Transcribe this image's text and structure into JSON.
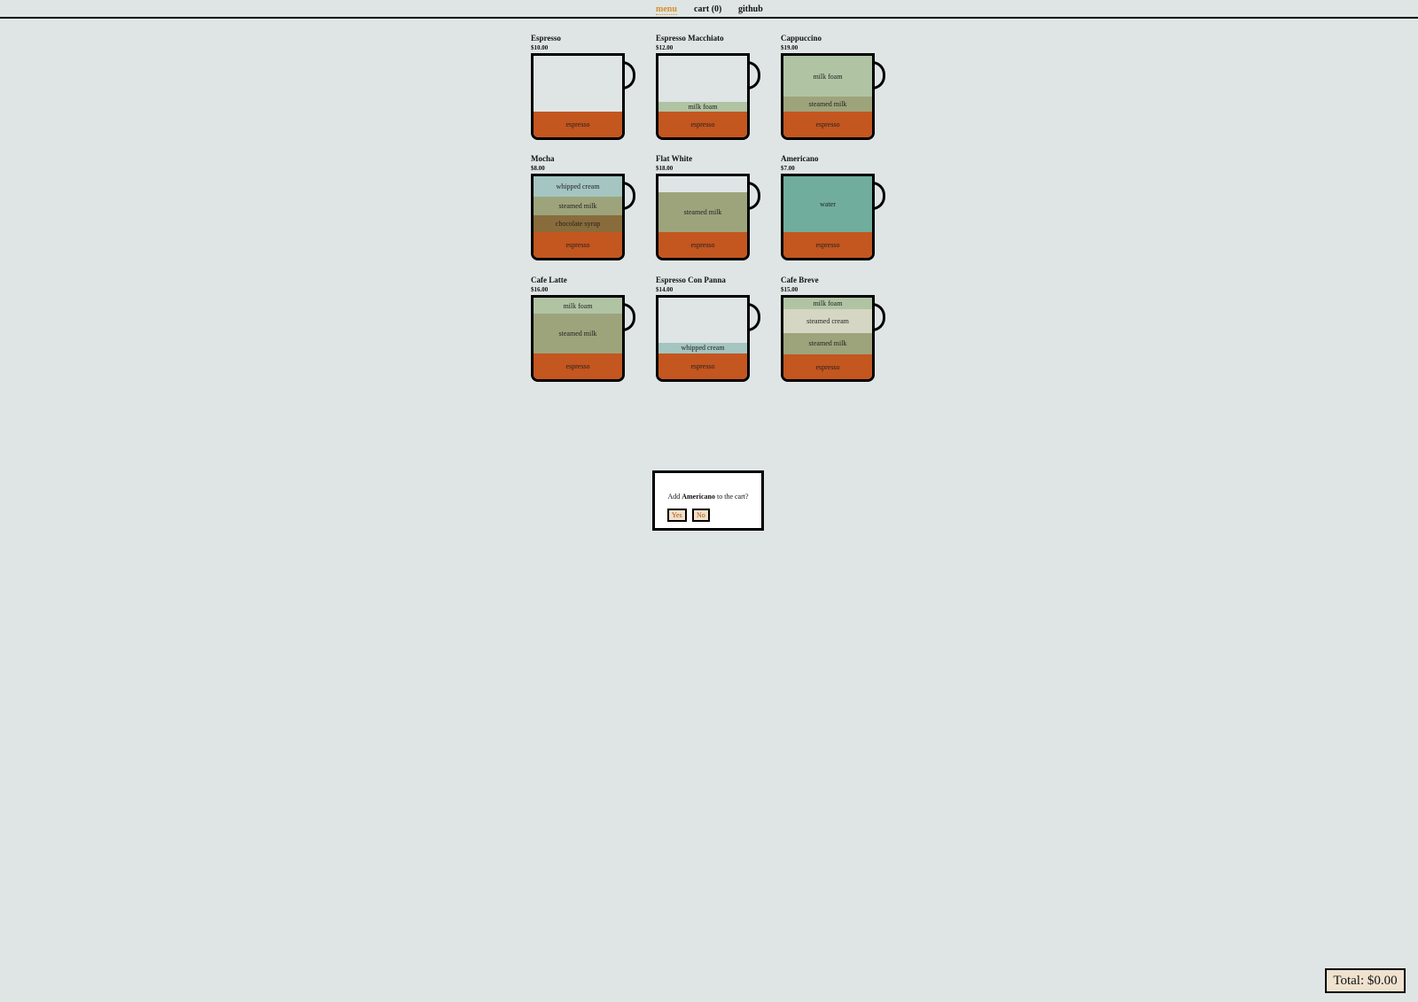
{
  "nav": {
    "menu_label": "menu",
    "cart_label": "cart (0)",
    "github_label": "github"
  },
  "colors": {
    "background": "#dfe5e5",
    "active_nav": "#d4902a",
    "espresso": "#c4561f",
    "milk_foam": "#b0c4a4",
    "steamed_milk": "#9da47b",
    "chocolate_syrup": "#896c3b",
    "whipped_cream": "#a4c5c1",
    "water": "#70ad9c",
    "steamed_cream": "#d5d6c3",
    "button_bg": "#f0e0c8",
    "total_bg": "#efe2cf"
  },
  "products": [
    {
      "name": "Espresso",
      "price": "$10.00",
      "empty_fraction": 0.68,
      "layers": [
        {
          "label": "espresso",
          "color": "#c4561f",
          "fraction": 0.32
        }
      ]
    },
    {
      "name": "Espresso Macchiato",
      "price": "$12.00",
      "empty_fraction": 0.56,
      "layers": [
        {
          "label": "milk foam",
          "color": "#b0c4a4",
          "fraction": 0.12
        },
        {
          "label": "espresso",
          "color": "#c4561f",
          "fraction": 0.32
        }
      ]
    },
    {
      "name": "Cappuccino",
      "price": "$19.00",
      "empty_fraction": 0,
      "layers": [
        {
          "label": "milk foam",
          "color": "#b0c4a4",
          "fraction": 0.5
        },
        {
          "label": "steamed milk",
          "color": "#9da47b",
          "fraction": 0.18
        },
        {
          "label": "espresso",
          "color": "#c4561f",
          "fraction": 0.32
        }
      ]
    },
    {
      "name": "Mocha",
      "price": "$8.00",
      "empty_fraction": 0,
      "layers": [
        {
          "label": "whipped cream",
          "color": "#a4c5c1",
          "fraction": 0.25
        },
        {
          "label": "steamed milk",
          "color": "#9da47b",
          "fraction": 0.23
        },
        {
          "label": "chocolate syrup",
          "color": "#896c3b",
          "fraction": 0.2
        },
        {
          "label": "espresso",
          "color": "#c4561f",
          "fraction": 0.32
        }
      ]
    },
    {
      "name": "Flat White",
      "price": "$18.00",
      "empty_fraction": 0.2,
      "layers": [
        {
          "label": "steamed milk",
          "color": "#9da47b",
          "fraction": 0.48
        },
        {
          "label": "espresso",
          "color": "#c4561f",
          "fraction": 0.32
        }
      ]
    },
    {
      "name": "Americano",
      "price": "$7.00",
      "empty_fraction": 0,
      "layers": [
        {
          "label": "water",
          "color": "#70ad9c",
          "fraction": 0.68
        },
        {
          "label": "espresso",
          "color": "#c4561f",
          "fraction": 0.32
        }
      ]
    },
    {
      "name": "Cafe Latte",
      "price": "$16.00",
      "empty_fraction": 0,
      "layers": [
        {
          "label": "milk foam",
          "color": "#b0c4a4",
          "fraction": 0.2
        },
        {
          "label": "steamed milk",
          "color": "#9da47b",
          "fraction": 0.48
        },
        {
          "label": "espresso",
          "color": "#c4561f",
          "fraction": 0.32
        }
      ]
    },
    {
      "name": "Espresso Con Panna",
      "price": "$14.00",
      "empty_fraction": 0.55,
      "layers": [
        {
          "label": "whipped cream",
          "color": "#a4c5c1",
          "fraction": 0.13
        },
        {
          "label": "espresso",
          "color": "#c4561f",
          "fraction": 0.32
        }
      ]
    },
    {
      "name": "Cafe Breve",
      "price": "$15.00",
      "empty_fraction": 0,
      "layers": [
        {
          "label": "milk foam",
          "color": "#b0c4a4",
          "fraction": 0.14
        },
        {
          "label": "steamed cream",
          "color": "#d5d6c3",
          "fraction": 0.29
        },
        {
          "label": "steamed milk",
          "color": "#9da47b",
          "fraction": 0.27
        },
        {
          "label": "espresso",
          "color": "#c4561f",
          "fraction": 0.3
        }
      ]
    }
  ],
  "modal": {
    "prefix": "Add",
    "product": "Americano",
    "suffix": "to the cart?",
    "yes_label": "Yes",
    "no_label": "No"
  },
  "cart": {
    "total_label": "Total: $0.00"
  }
}
